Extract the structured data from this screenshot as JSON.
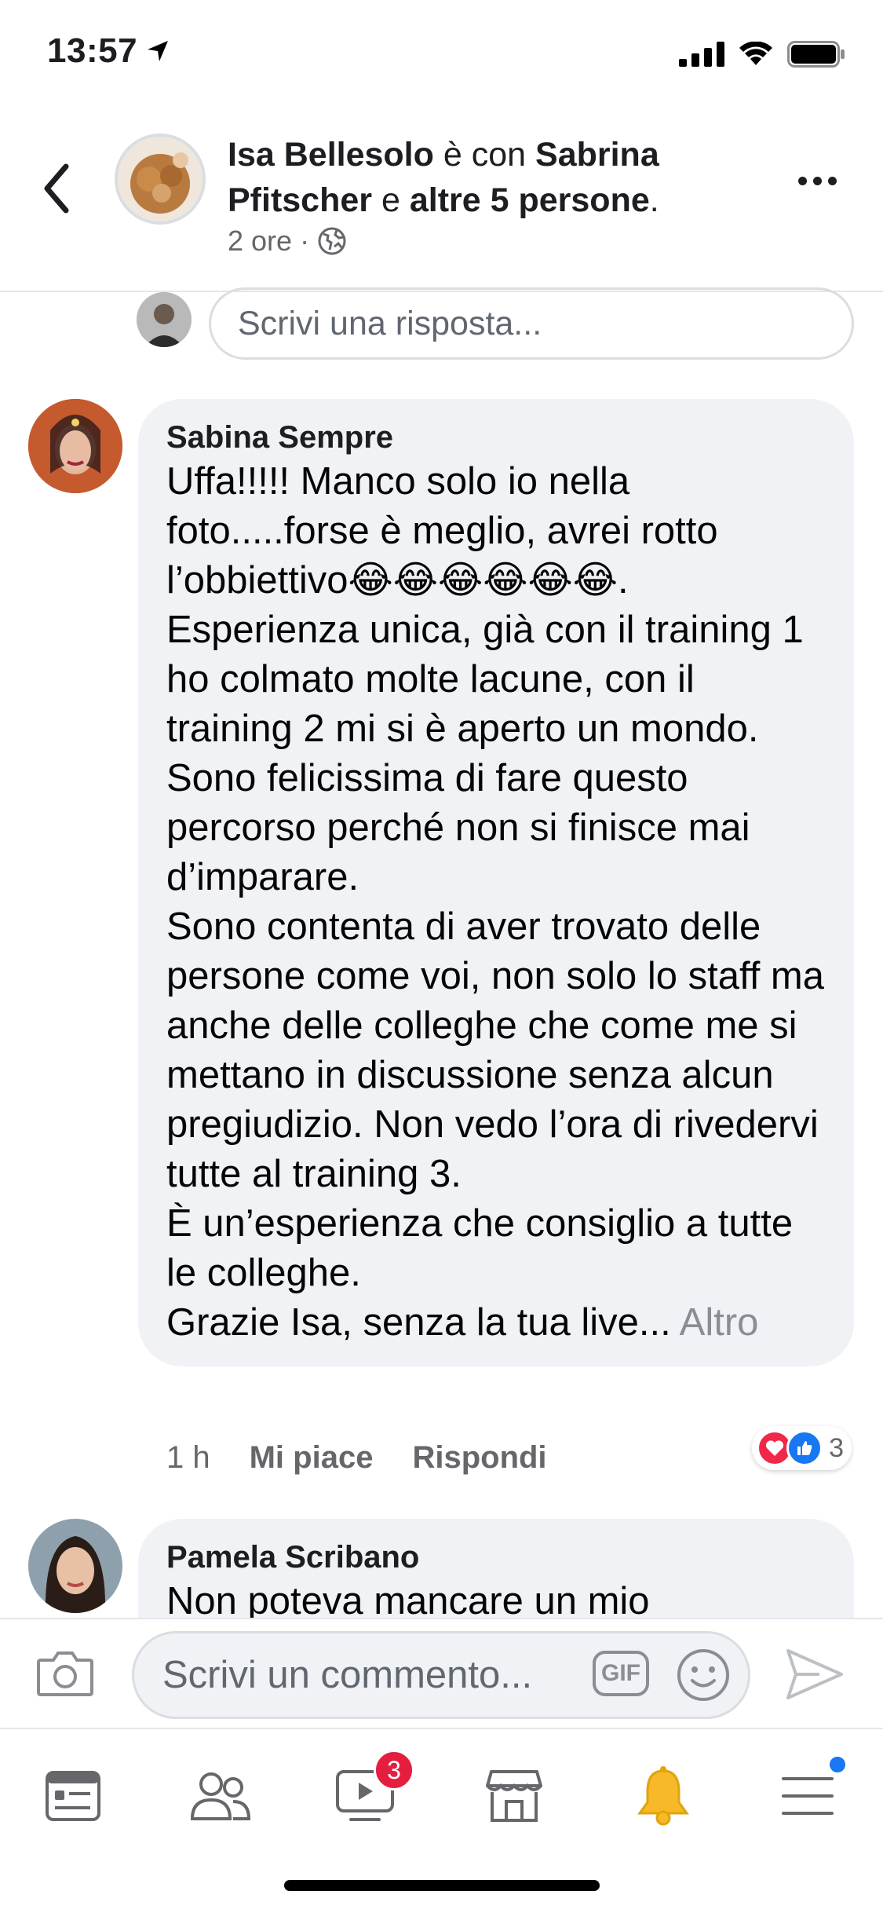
{
  "status_bar": {
    "time": "13:57"
  },
  "header": {
    "author": "Isa Bellesolo",
    "connector": "è con",
    "tagged": "Sabrina Pfitscher",
    "and": "e",
    "others": "altre 5 persone",
    "period": ".",
    "time": "2 ore",
    "separator": "·"
  },
  "reply_box": {
    "placeholder": "Scrivi una risposta..."
  },
  "comments": [
    {
      "name": "Sabina Sempre",
      "text": "Uffa!!!!! Manco solo io nella foto.....forse è meglio, avrei rotto l’obbiettivo😂😂😂😂😂😂.\nEsperienza unica, già con il training 1 ho colmato molte lacune, con il training 2 mi si è aperto un mondo. Sono felicissima di fare questo percorso perché non si finisce mai d’imparare.\nSono contenta di aver trovato delle persone come voi, non solo lo staff ma anche delle colleghe che come me si mettano in discussione senza alcun pregiudizio. Non vedo l’ora di rivedervi tutte al training 3.\nÈ un’esperienza che consiglio a tutte le colleghe.\nGrazie Isa, senza la tua live...",
      "more": "Altro",
      "time": "1 h",
      "like": "Mi piace",
      "reply": "Rispondi",
      "reaction_count": "3"
    },
    {
      "name": "Pamela Scribano",
      "text": "Non poteva mancare un mio"
    }
  ],
  "composer": {
    "placeholder": "Scrivi un commento...",
    "gif": "GIF"
  },
  "tabbar": {
    "video_badge": "3"
  },
  "colors": {
    "accent": "#1877f2",
    "badge": "#e41e3f",
    "notif_bell": "#f7b928"
  }
}
